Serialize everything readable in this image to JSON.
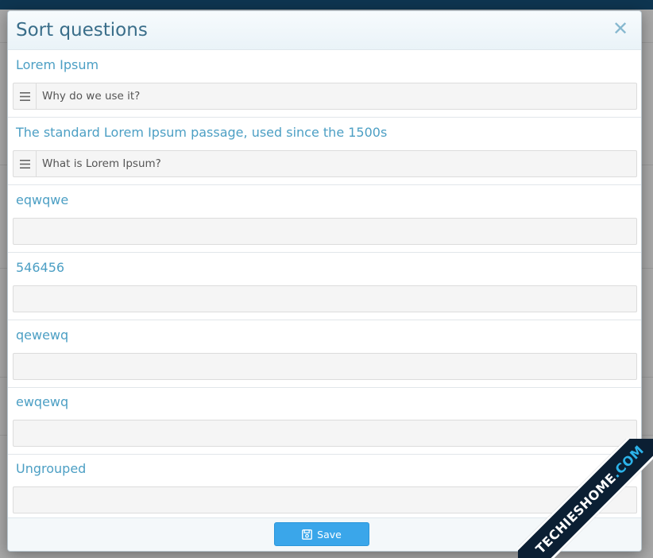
{
  "modal": {
    "title": "Sort questions",
    "close_icon": "close-icon"
  },
  "groups": [
    {
      "title": "Lorem Ipsum",
      "questions": [
        "Why do we use it?"
      ]
    },
    {
      "title": "The standard Lorem Ipsum passage, used since the 1500s",
      "questions": [
        "What is Lorem Ipsum?"
      ]
    },
    {
      "title": "eqwqwe",
      "questions": []
    },
    {
      "title": "546456",
      "questions": []
    },
    {
      "title": "qewewq",
      "questions": []
    },
    {
      "title": "ewqewq",
      "questions": []
    },
    {
      "title": "Ungrouped",
      "questions": []
    }
  ],
  "footer": {
    "save_label": "Save",
    "save_icon": "floppy-disk-icon"
  },
  "watermark": {
    "text_main": "TECHIESHOME",
    "text_accent": ".COM"
  },
  "colors": {
    "title": "#3a6e8a",
    "group_title": "#4c9fc4",
    "save_button": "#3aa6ea",
    "top_bar": "#0e3550"
  }
}
